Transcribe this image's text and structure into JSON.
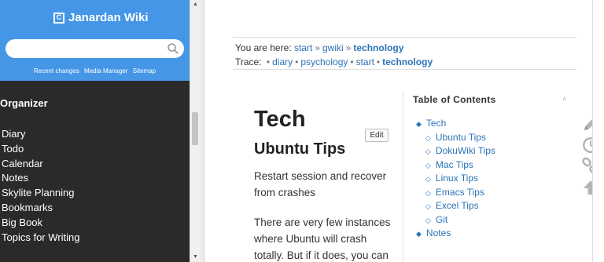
{
  "sidebar": {
    "title": "Janardan Wiki",
    "logo_letter": "C",
    "search": {
      "placeholder": "",
      "value": ""
    },
    "links": [
      "Recent changes",
      "Media Manager",
      "Sitemap"
    ],
    "section_title": "Organizer",
    "items": [
      "Diary",
      "Todo",
      "Calendar",
      "Notes",
      "Skylite Planning",
      "Bookmarks",
      "Big Book",
      "Topics for Writing"
    ]
  },
  "breadcrumbs": {
    "you_are_here_label": "You are here:",
    "path": [
      "start",
      "gwiki",
      "technology"
    ],
    "path_sep": "»",
    "trace_label": "Trace:",
    "trace": [
      "diary",
      "psychology",
      "start",
      "technology"
    ],
    "trace_sep": "•"
  },
  "content": {
    "page_title": "Tech",
    "section_title": "Ubuntu Tips",
    "paragraph1": "Restart session and recover from crashes",
    "paragraph2": "There are very few instances where Ubuntu will crash totally. But if it does, you can",
    "edit_label": "Edit"
  },
  "toc": {
    "title": "Table of Contents",
    "toggle": "˄",
    "items": [
      {
        "label": "Tech",
        "level": 1
      },
      {
        "label": "Ubuntu Tips",
        "level": 2
      },
      {
        "label": "DokuWiki Tips",
        "level": 2
      },
      {
        "label": "Mac Tips",
        "level": 2
      },
      {
        "label": "Linux Tips",
        "level": 2
      },
      {
        "label": "Emacs Tips",
        "level": 2
      },
      {
        "label": "Excel Tips",
        "level": 2
      },
      {
        "label": "Git",
        "level": 2
      },
      {
        "label": "Notes",
        "level": 1
      }
    ]
  },
  "tools": [
    "edit-pencil-icon",
    "history-clock-icon",
    "link-icon",
    "back-to-top-icon"
  ],
  "colors": {
    "accent": "#4596e6",
    "sidebar_bg": "#2a2a2a",
    "link": "#2b73b7",
    "tool_icon": "#b5b5b5"
  }
}
